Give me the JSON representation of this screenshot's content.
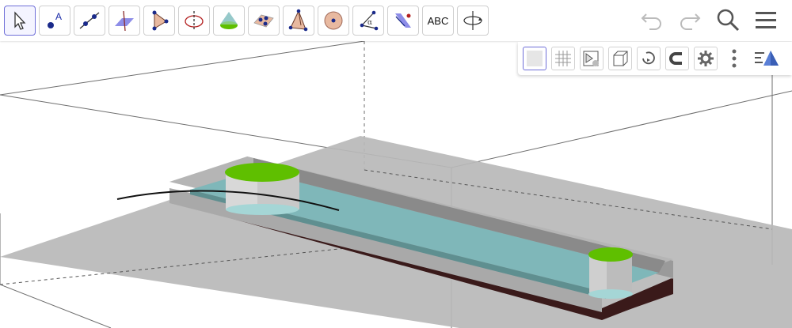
{
  "toolbar": {
    "tools": [
      {
        "name": "move-tool",
        "active": true
      },
      {
        "name": "point-tool"
      },
      {
        "name": "line-tool"
      },
      {
        "name": "perpendicular-line-tool"
      },
      {
        "name": "polygon-tool"
      },
      {
        "name": "circle-axis-tool"
      },
      {
        "name": "cone-tool"
      },
      {
        "name": "plane-through-points-tool"
      },
      {
        "name": "pyramid-tool"
      },
      {
        "name": "sphere-tool"
      },
      {
        "name": "angle-tool"
      },
      {
        "name": "reflect-tool"
      },
      {
        "name": "text-tool",
        "label": "ABC"
      },
      {
        "name": "rotate-view-tool"
      }
    ],
    "undo_icon": "undo-icon",
    "redo_icon": "redo-icon",
    "search_icon": "search-icon",
    "menu_icon": "hamburger-menu-icon"
  },
  "style_bar": {
    "buttons": [
      "background-toggle",
      "grid-toggle",
      "projection-toggle",
      "view-direction",
      "rotate-view",
      "point-capturing",
      "settings",
      "more-options"
    ],
    "graphics_view_icon": "graphics-3d-icon"
  },
  "colors": {
    "accent": "#6f6fd8",
    "floor": "#b9b9b9",
    "water": "#8fc2c2",
    "cylinder_top": "#5fbf00",
    "base_dark": "#3a1a1a"
  }
}
